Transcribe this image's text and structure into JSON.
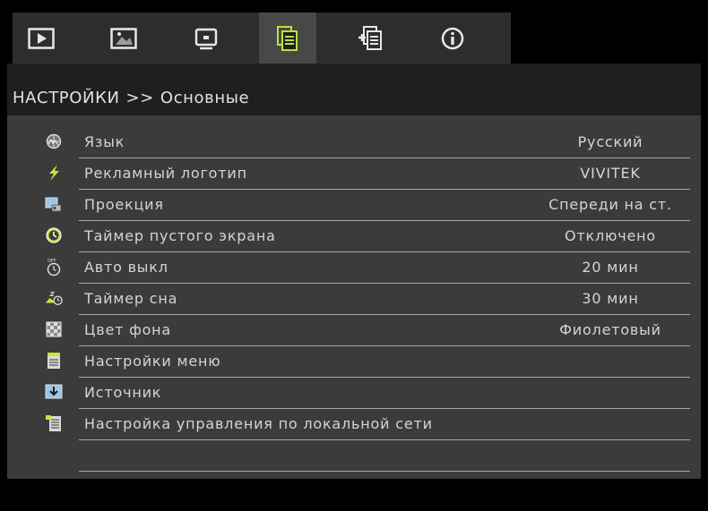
{
  "tabs": [
    {
      "icon": "play-screen-icon",
      "active": false
    },
    {
      "icon": "picture-icon",
      "active": false
    },
    {
      "icon": "display-icon",
      "active": false
    },
    {
      "icon": "settings-document-icon",
      "active": true
    },
    {
      "icon": "advanced-settings-icon",
      "active": false
    },
    {
      "icon": "info-icon",
      "active": false
    }
  ],
  "breadcrumb": {
    "section": "НАСТРОЙКИ",
    "separator": ">>",
    "page": "Основные"
  },
  "menu": {
    "items": [
      {
        "label": "Язык",
        "value": "Русский",
        "icon": "language-globe-icon"
      },
      {
        "label": "Рекламный логотип",
        "value": "VIVITEK",
        "icon": "lightning-icon"
      },
      {
        "label": "Проекция",
        "value": "Спереди на ст.",
        "icon": "projection-icon"
      },
      {
        "label": "Таймер пустого экрана",
        "value": "Отключено",
        "icon": "timer-icon"
      },
      {
        "label": "Авто выкл",
        "value": "20 мин",
        "icon": "auto-off-icon"
      },
      {
        "label": "Таймер сна",
        "value": "30 мин",
        "icon": "sleep-timer-icon"
      },
      {
        "label": "Цвет фона",
        "value": "Фиолетовый",
        "icon": "background-color-icon"
      },
      {
        "label": "Настройки меню",
        "value": "",
        "icon": "menu-settings-icon"
      },
      {
        "label": "Источник",
        "value": "",
        "icon": "source-icon"
      },
      {
        "label": "Настройка управления по локальной сети",
        "value": "",
        "icon": "lan-settings-icon"
      },
      {
        "label": "",
        "value": "",
        "icon": ""
      }
    ]
  }
}
